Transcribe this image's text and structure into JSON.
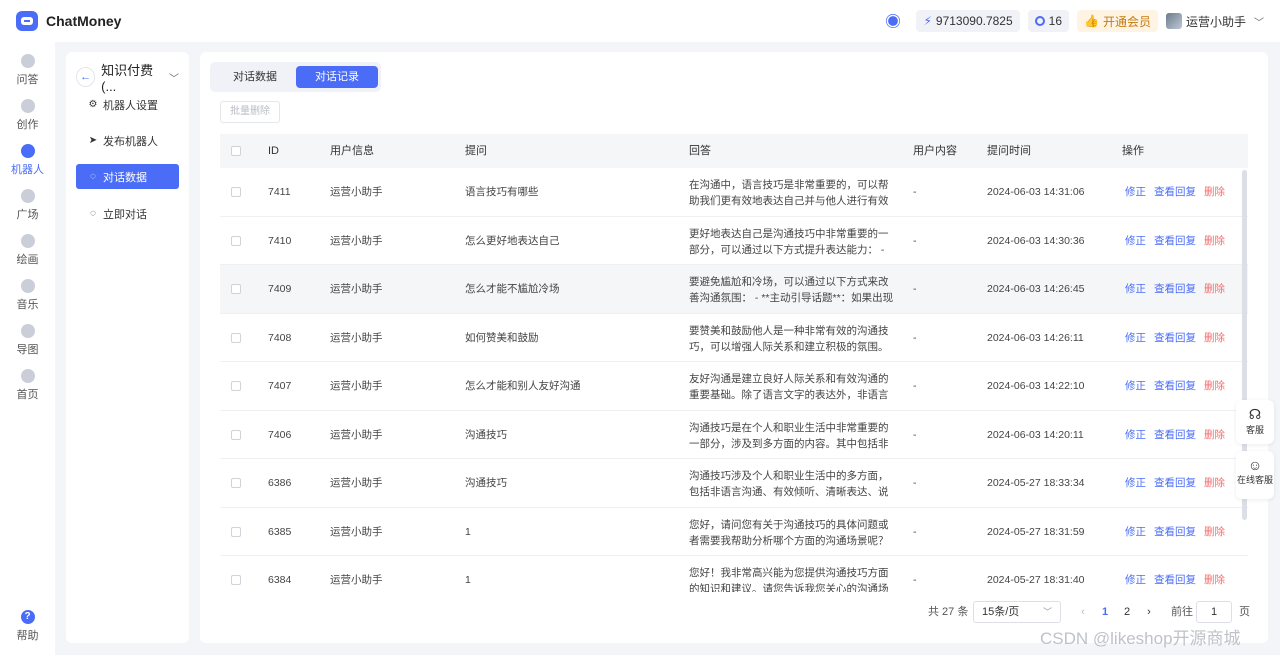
{
  "app": {
    "name": "ChatMoney"
  },
  "header": {
    "balance": "9713090.7825",
    "count": "16",
    "vip_label": "开通会员",
    "user_name": "运营小助手"
  },
  "rail": {
    "items": [
      {
        "label": "问答",
        "icon": "chat-icon"
      },
      {
        "label": "创作",
        "icon": "pen-icon"
      },
      {
        "label": "机器人",
        "icon": "robot-icon"
      },
      {
        "label": "广场",
        "icon": "grid-icon"
      },
      {
        "label": "绘画",
        "icon": "palette-icon"
      },
      {
        "label": "音乐",
        "icon": "music-icon"
      },
      {
        "label": "导图",
        "icon": "mindmap-icon"
      },
      {
        "label": "首页",
        "icon": "home-icon"
      }
    ],
    "help_label": "帮助"
  },
  "submenu": {
    "title": "知识付费(...",
    "items": [
      {
        "label": "机器人设置",
        "icon": "gear-icon"
      },
      {
        "label": "发布机器人",
        "icon": "send-icon"
      },
      {
        "label": "对话数据",
        "icon": "chat-bubble-icon"
      },
      {
        "label": "立即对话",
        "icon": "chat-bubble-icon"
      }
    ]
  },
  "tabs": [
    "对话数据",
    "对话记录"
  ],
  "batch_delete_label": "批量删除",
  "table": {
    "columns": [
      "ID",
      "用户信息",
      "提问",
      "回答",
      "用户内容",
      "提问时间",
      "操作"
    ],
    "op_labels": {
      "edit": "修正",
      "view": "查看回复",
      "delete": "删除"
    },
    "rows": [
      {
        "id": "7411",
        "user": "运营小助手",
        "question": "语言技巧有哪些",
        "answer": "在沟通中，语言技巧是非常重要的，可以帮助我们更有效地表达自己并与他人进行有效的交流...",
        "content": "-",
        "time": "2024-06-03 14:31:06"
      },
      {
        "id": "7410",
        "user": "运营小助手",
        "question": "怎么更好地表达自己",
        "answer": "更好地表达自己是沟通技巧中非常重要的一部分，可以通过以下方式提升表达能力： - **清...",
        "content": "-",
        "time": "2024-06-03 14:30:36"
      },
      {
        "id": "7409",
        "user": "运营小助手",
        "question": "怎么才能不尴尬冷场",
        "answer": "要避免尴尬和冷场，可以通过以下方式来改善沟通氛围： - **主动引导话题**：如果出现尴尬...",
        "content": "-",
        "time": "2024-06-03 14:26:45"
      },
      {
        "id": "7408",
        "user": "运营小助手",
        "question": "如何赞美和鼓励",
        "answer": "要赞美和鼓励他人是一种非常有效的沟通技巧，可以增强人际关系和建立积极的氛围。以下是...",
        "content": "-",
        "time": "2024-06-03 14:26:11"
      },
      {
        "id": "7407",
        "user": "运营小助手",
        "question": "怎么才能和别人友好沟通",
        "answer": "友好沟通是建立良好人际关系和有效沟通的重要基础。除了语言文字的表达外，非语言沟通也...",
        "content": "-",
        "time": "2024-06-03 14:22:10"
      },
      {
        "id": "7406",
        "user": "运营小助手",
        "question": "沟通技巧",
        "answer": "沟通技巧是在个人和职业生活中非常重要的一部分，涉及到多方面的内容。其中包括非语言沟...",
        "content": "-",
        "time": "2024-06-03 14:20:11"
      },
      {
        "id": "6386",
        "user": "运营小助手",
        "question": "沟通技巧",
        "answer": "沟通技巧涉及个人和职业生活中的多方面，包括非语言沟通、有效倾听、清晰表达、说服力与...",
        "content": "-",
        "time": "2024-05-27 18:33:34"
      },
      {
        "id": "6385",
        "user": "运营小助手",
        "question": "1",
        "answer": "您好，请问您有关于沟通技巧的具体问题或者需要我帮助分析哪个方面的沟通场景呢？请告诉...",
        "content": "-",
        "time": "2024-05-27 18:31:59"
      },
      {
        "id": "6384",
        "user": "运营小助手",
        "question": "1",
        "answer": "您好！我非常高兴能为您提供沟通技巧方面的知识和建议。请您告诉我您关心的沟通场景和问...",
        "content": "-",
        "time": "2024-05-27 18:31:40"
      }
    ]
  },
  "pagination": {
    "total": "共 27 条",
    "page_size": "15条/页",
    "pages": [
      "1",
      "2"
    ],
    "current": "1",
    "goto_label": "前往",
    "goto_value": "1",
    "page_suffix": "页"
  },
  "float": {
    "service": "客服",
    "online_service": "在线客服"
  },
  "watermark": "CSDN @likeshop开源商城",
  "colors": {
    "accent": "#4a6cf7",
    "danger": "#f56c6c",
    "vip": "#c47a12"
  }
}
